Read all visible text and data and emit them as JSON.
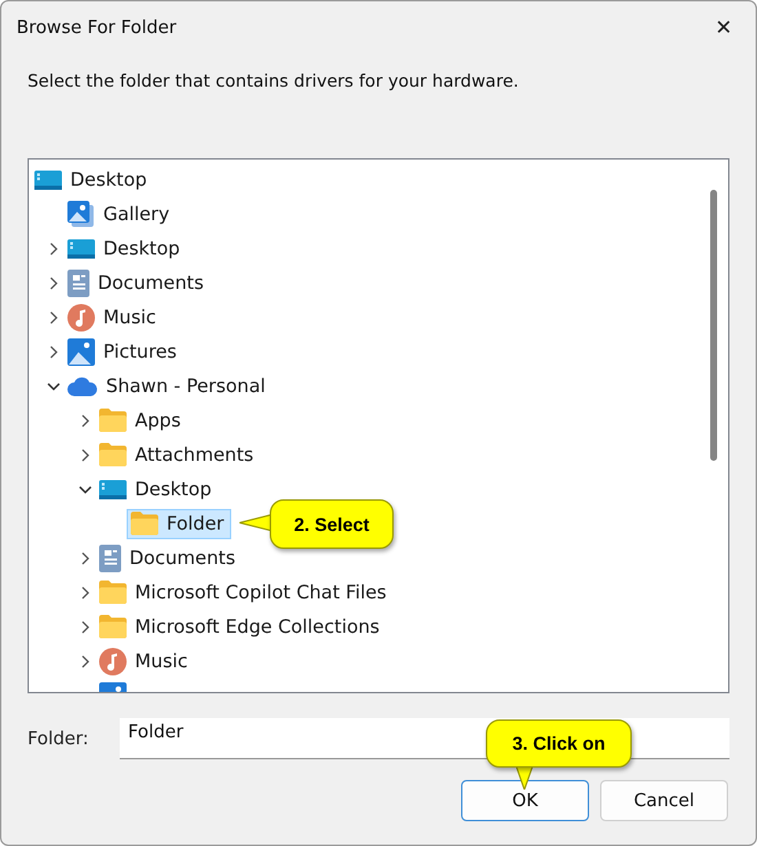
{
  "window": {
    "title": "Browse For Folder",
    "close": "✕"
  },
  "instruction": "Select the folder that contains drivers for your hardware.",
  "tree": {
    "items": [
      {
        "label": "Desktop",
        "kind": "desktop",
        "selected": false,
        "children": [
          {
            "label": "Gallery",
            "kind": "gallery",
            "selected": false
          },
          {
            "label": "Desktop",
            "kind": "desktop",
            "expanded": false,
            "selected": false
          },
          {
            "label": "Documents",
            "kind": "documents",
            "expanded": false,
            "selected": false
          },
          {
            "label": "Music",
            "kind": "music",
            "expanded": false,
            "selected": false
          },
          {
            "label": "Pictures",
            "kind": "pictures",
            "expanded": false,
            "selected": false
          },
          {
            "label": "Shawn - Personal",
            "kind": "cloud",
            "expanded": true,
            "selected": false,
            "children": [
              {
                "label": "Apps",
                "kind": "folder",
                "expanded": false,
                "selected": false
              },
              {
                "label": "Attachments",
                "kind": "folder",
                "expanded": false,
                "selected": false
              },
              {
                "label": "Desktop",
                "kind": "desktop",
                "expanded": true,
                "selected": false,
                "children": [
                  {
                    "label": "Folder",
                    "kind": "folder",
                    "selected": true
                  }
                ]
              },
              {
                "label": "Documents",
                "kind": "documents",
                "expanded": false,
                "selected": false
              },
              {
                "label": "Microsoft Copilot Chat Files",
                "kind": "folder",
                "expanded": false,
                "selected": false
              },
              {
                "label": "Microsoft Edge Collections",
                "kind": "folder",
                "expanded": false,
                "selected": false
              },
              {
                "label": "Music",
                "kind": "music",
                "expanded": false,
                "selected": false
              },
              {
                "kind": "pictures",
                "selected": false
              }
            ]
          }
        ]
      }
    ]
  },
  "folder_field": {
    "label": "Folder:",
    "value": "Folder"
  },
  "buttons": [
    {
      "label": "OK",
      "default": true
    },
    {
      "label": "Cancel",
      "default": false
    }
  ],
  "callouts": [
    {
      "text": "2. Select",
      "kind": "left"
    },
    {
      "text": "3. Click on",
      "kind": "down"
    }
  ]
}
